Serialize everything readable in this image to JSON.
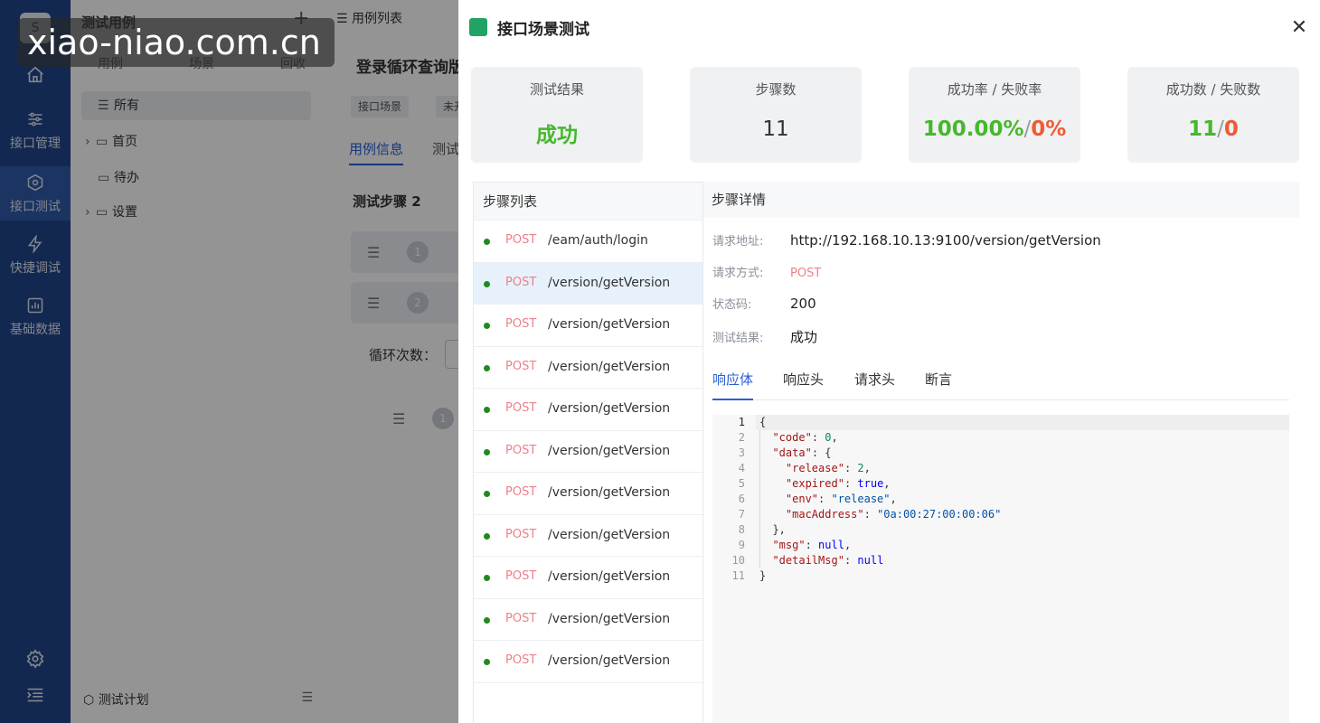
{
  "nav": {
    "logo": "S",
    "items": [
      {
        "label": ""
      },
      {
        "label": "接口管理"
      },
      {
        "label": "接口测试"
      },
      {
        "label": "快捷调试"
      },
      {
        "label": "基础数据"
      }
    ]
  },
  "tree": {
    "title": "测试用例",
    "tabs": [
      "用例",
      "场景",
      "回收"
    ],
    "nodes": [
      {
        "label": "所有"
      },
      {
        "label": "首页"
      },
      {
        "label": "待办"
      },
      {
        "label": "设置"
      }
    ],
    "footer": "测试计划"
  },
  "main": {
    "topbar": "用例列表",
    "case_title": "登录循环查询版",
    "tags": [
      "接口场景",
      "未开"
    ],
    "tabs": [
      "用例信息",
      "测试"
    ],
    "step_title": "测试步骤 2",
    "step_nums": [
      "1",
      "2",
      "1"
    ],
    "loop_label": "循环次数："
  },
  "drawer": {
    "title": "接口场景测试",
    "stats": [
      {
        "label": "测试结果",
        "value": "成功"
      },
      {
        "label": "步骤数",
        "value": "11"
      },
      {
        "label": "成功率 / 失败率",
        "a": "100.00%",
        "b": "0%"
      },
      {
        "label": "成功数 / 失败数",
        "a": "11",
        "b": "0"
      }
    ],
    "list_title": "步骤列表",
    "steps": [
      {
        "method": "POST",
        "path": "/eam/auth/login"
      },
      {
        "method": "POST",
        "path": "/version/getVersion"
      },
      {
        "method": "POST",
        "path": "/version/getVersion"
      },
      {
        "method": "POST",
        "path": "/version/getVersion"
      },
      {
        "method": "POST",
        "path": "/version/getVersion"
      },
      {
        "method": "POST",
        "path": "/version/getVersion"
      },
      {
        "method": "POST",
        "path": "/version/getVersion"
      },
      {
        "method": "POST",
        "path": "/version/getVersion"
      },
      {
        "method": "POST",
        "path": "/version/getVersion"
      },
      {
        "method": "POST",
        "path": "/version/getVersion"
      },
      {
        "method": "POST",
        "path": "/version/getVersion"
      }
    ],
    "detail_title": "步骤详情",
    "detail": {
      "url_label": "请求地址:",
      "url": "http://192.168.10.13:9100/version/getVersion",
      "method_label": "请求方式:",
      "method": "POST",
      "status_label": "状态码:",
      "status": "200",
      "result_label": "测试结果:",
      "result": "成功"
    },
    "tabs": [
      "响应体",
      "响应头",
      "请求头",
      "断言"
    ],
    "code_lines": [
      "1",
      "2",
      "3",
      "4",
      "5",
      "6",
      "7",
      "8",
      "9",
      "10",
      "11"
    ]
  },
  "watermark": "xiao-niao.com.cn",
  "colors": {
    "nav": "#21468a",
    "success": "#46b82c",
    "fail": "#ef5b34",
    "accent": "#2a5fd6",
    "method": "#ee7f8a"
  }
}
